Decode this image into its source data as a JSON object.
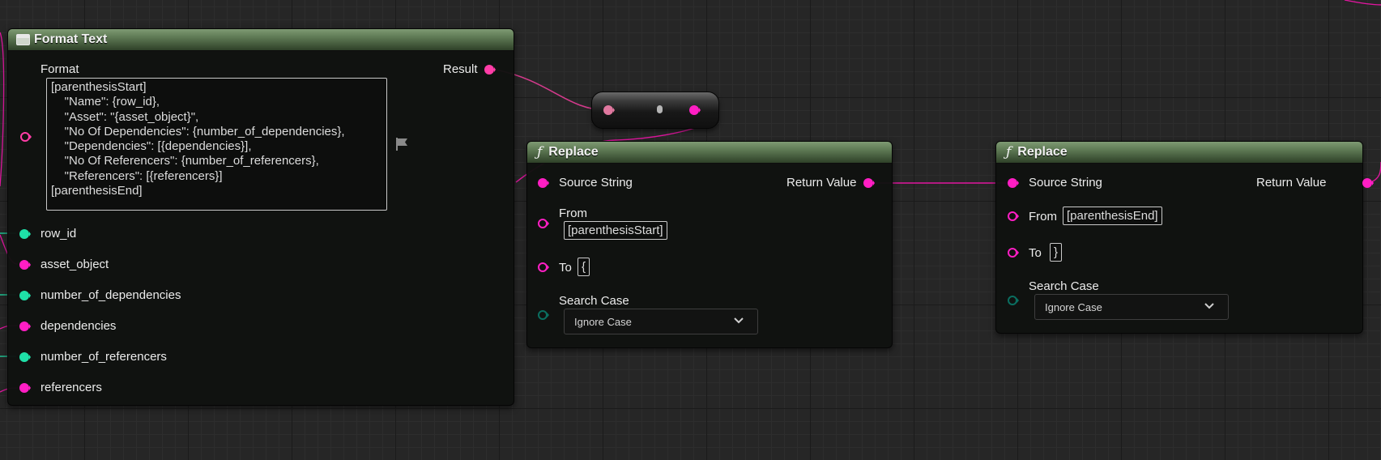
{
  "format_text_node": {
    "title": "Format Text",
    "format_label": "Format",
    "format_value": "[parenthesisStart]\n    \"Name\": {row_id},\n    \"Asset\": \"{asset_object}\",\n    \"No Of Dependencies\": {number_of_dependencies},\n    \"Dependencies\": [{dependencies}],\n    \"No Of Referencers\": {number_of_referencers},\n    \"Referencers\": [{referencers}]\n[parenthesisEnd]",
    "result_label": "Result",
    "args": [
      {
        "label": "row_id",
        "type": "int"
      },
      {
        "label": "asset_object",
        "type": "string"
      },
      {
        "label": "number_of_dependencies",
        "type": "int"
      },
      {
        "label": "dependencies",
        "type": "string"
      },
      {
        "label": "number_of_referencers",
        "type": "int"
      },
      {
        "label": "referencers",
        "type": "string"
      }
    ]
  },
  "replace_node_1": {
    "title": "Replace",
    "source_label": "Source String",
    "return_label": "Return Value",
    "from_label": "From",
    "from_value": "[parenthesisStart]",
    "to_label": "To",
    "to_value": "{",
    "search_case_label": "Search Case",
    "search_case_value": "Ignore Case"
  },
  "replace_node_2": {
    "title": "Replace",
    "source_label": "Source String",
    "return_label": "Return Value",
    "from_label": "From",
    "from_value": "[parenthesisEnd]",
    "to_label": "To",
    "to_value": "}",
    "search_case_label": "Search Case",
    "search_case_value": "Ignore Case"
  },
  "colors": {
    "text_pin": "#ff3da7",
    "string_pin": "#ff1ec4",
    "int_pin": "#1fe0a8",
    "enum_pin": "#0a5e52",
    "wire": "#e0169f",
    "header_green": "#5d7853"
  },
  "icons": {
    "format_node": "node-window-icon",
    "function": "function-icon",
    "flag": "flag-icon",
    "dropdown": "chevron-down-icon"
  }
}
